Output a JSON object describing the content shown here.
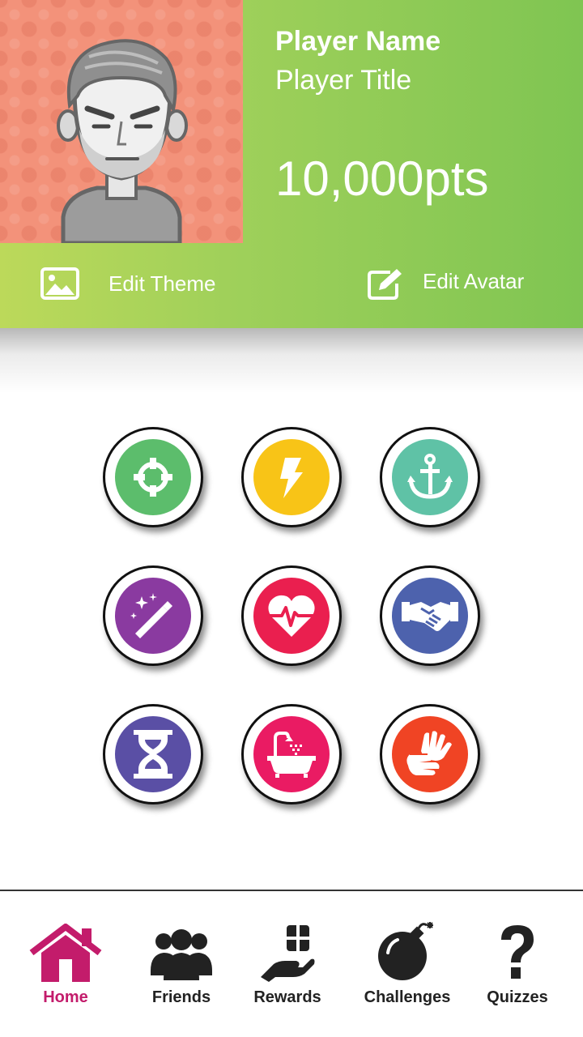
{
  "profile": {
    "name": "Player Name",
    "title": "Player Title",
    "points": "10,000pts"
  },
  "actions": {
    "edit_theme": "Edit Theme",
    "edit_avatar": "Edit Avatar"
  },
  "badges": [
    {
      "icon": "crosshair-icon",
      "color": "#5cbd6c"
    },
    {
      "icon": "lightning-icon",
      "color": "#f8c417"
    },
    {
      "icon": "anchor-icon",
      "color": "#5fc2a6"
    },
    {
      "icon": "magic-wand-icon",
      "color": "#8a3aa0"
    },
    {
      "icon": "heartbeat-icon",
      "color": "#ea1f4f"
    },
    {
      "icon": "handshake-icon",
      "color": "#4d62ad"
    },
    {
      "icon": "hourglass-icon",
      "color": "#5a4fa5"
    },
    {
      "icon": "bathtub-icon",
      "color": "#ea1b63"
    },
    {
      "icon": "sign-language-icon",
      "color": "#f04424"
    }
  ],
  "nav": {
    "items": [
      {
        "label": "Home",
        "icon": "home-icon",
        "active": true
      },
      {
        "label": "Friends",
        "icon": "friends-icon"
      },
      {
        "label": "Rewards",
        "icon": "gift-hand-icon"
      },
      {
        "label": "Challenges",
        "icon": "bomb-icon"
      },
      {
        "label": "Quizzes",
        "icon": "question-mark-icon"
      }
    ],
    "active_color": "#c31c6b"
  },
  "colors": {
    "header_gradient_start": "#bcd95a",
    "header_gradient_end": "#7fc552",
    "avatar_background": "#f3927a"
  }
}
